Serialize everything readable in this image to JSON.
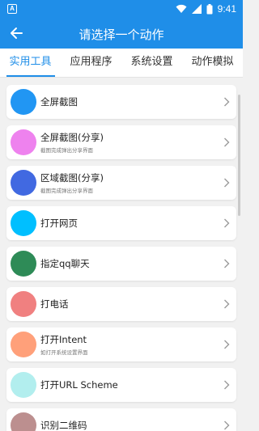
{
  "status_bar": {
    "time": "9:41",
    "app_badge": "A",
    "icons": [
      "notification-badge-icon",
      "wifi-icon",
      "signal-icon",
      "battery-icon"
    ]
  },
  "app_bar": {
    "title": "请选择一个动作",
    "back_icon": "arrow-left-icon"
  },
  "tabs": [
    {
      "label": "实用工具",
      "active": true
    },
    {
      "label": "应用程序",
      "active": false
    },
    {
      "label": "系统设置",
      "active": false
    },
    {
      "label": "动作模拟",
      "active": false
    }
  ],
  "actions": [
    {
      "name": "全屏截图",
      "desc": "",
      "color": "#2196f3"
    },
    {
      "name": "全屏截图(分享)",
      "desc": "截图完成弹出分享界面",
      "color": "#ee82ee"
    },
    {
      "name": "区域截图(分享)",
      "desc": "截图完成弹出分享界面",
      "color": "#4169e1"
    },
    {
      "name": "打开网页",
      "desc": "",
      "color": "#00bfff"
    },
    {
      "name": "指定qq聊天",
      "desc": "",
      "color": "#2e8b57"
    },
    {
      "name": "打电话",
      "desc": "",
      "color": "#f08080"
    },
    {
      "name": "打开Intent",
      "desc": "如打开系统设置界面",
      "color": "#ffa07a"
    },
    {
      "name": "打开URL Scheme",
      "desc": "",
      "color": "#b2eeee"
    },
    {
      "name": "识别二维码",
      "desc": "",
      "color": "#bc8f8f"
    }
  ],
  "colors": {
    "primary": "#1f8ee8",
    "background": "#f1f1f1"
  }
}
